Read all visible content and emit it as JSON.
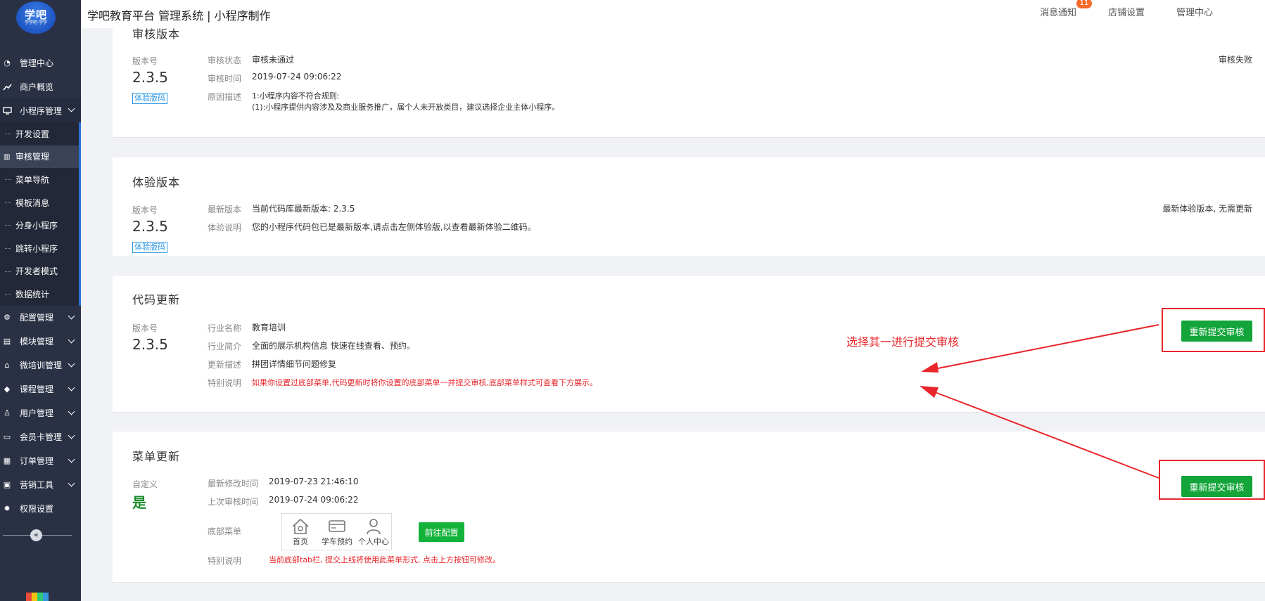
{
  "brand": {
    "logo_text": "学吧",
    "logo_sub": "学学吧·学学"
  },
  "header": {
    "title": "学吧教育平台 管理系统 | 小程序制作",
    "links": {
      "notifications": "消息通知",
      "notifications_badge": "11",
      "shop_settings": "店铺设置",
      "admin_center": "管理中心"
    }
  },
  "sidebar": {
    "items": [
      {
        "label": "管理中心",
        "icon": "dashboard-icon"
      },
      {
        "label": "商户概览",
        "icon": "chart-line-icon"
      },
      {
        "label": "小程序管理",
        "icon": "monitor-icon"
      },
      {
        "label": "配置管理",
        "icon": "cogs-icon"
      },
      {
        "label": "模块管理",
        "icon": "modules-icon"
      },
      {
        "label": "微培训管理",
        "icon": "home-icon"
      },
      {
        "label": "课程管理",
        "icon": "graduation-cap-icon"
      },
      {
        "label": "用户管理",
        "icon": "user-icon"
      },
      {
        "label": "会员卡管理",
        "icon": "id-card-icon"
      },
      {
        "label": "订单管理",
        "icon": "order-icon"
      },
      {
        "label": "营销工具",
        "icon": "briefcase-icon"
      },
      {
        "label": "权限设置",
        "icon": "gear-icon"
      }
    ],
    "subitems": [
      "开发设置",
      "审核管理",
      "菜单导航",
      "模板消息",
      "分身小程序",
      "跳转小程序",
      "开发者模式",
      "数据统计"
    ]
  },
  "audit": {
    "title": "审核版本",
    "version_label": "版本号",
    "version": "2.3.5",
    "tag": "体验版码",
    "status_label": "审核状态",
    "status": "审核未通过",
    "time_label": "审核时间",
    "time": "2019-07-24 09:06:22",
    "reason_label": "原因描述",
    "reason_line1": "1:小程序内容不符合规则:",
    "reason_line2": "(1):小程序提供内容涉及及商业服务推广，属个人未开放类目，建议选择企业主体小程序。",
    "right_status": "审核失败"
  },
  "trial": {
    "title": "体验版本",
    "version_label": "版本号",
    "version": "2.3.5",
    "tag": "体验版码",
    "latest_label": "最新版本",
    "latest": "当前代码库最新版本: 2.3.5",
    "desc_label": "体验说明",
    "desc": "您的小程序代码包已是最新版本,请点击左侧体验版,以查看最新体验二维码。",
    "right_status": "最新体验版本, 无需更新"
  },
  "code_update": {
    "title": "代码更新",
    "version_label": "版本号",
    "version": "2.3.5",
    "industry_label": "行业名称",
    "industry": "教育培训",
    "intro_label": "行业简介",
    "intro": "全面的展示机构信息 快速在线查看、预约。",
    "update_label": "更新描述",
    "update": "拼团详情细节问题修复",
    "special_label": "特别说明",
    "special": "如果你设置过底部菜单,代码更新时将你设置的底部菜单一并提交审核,底部菜单样式可查看下方展示。",
    "button": "重新提交审核"
  },
  "menu_update": {
    "title": "菜单更新",
    "custom_label": "自定义",
    "custom_value": "是",
    "modified_label": "最新修改时间",
    "modified": "2019-07-23 21:46:10",
    "last_audit_label": "上次审核时间",
    "last_audit": "2019-07-24 09:06:22",
    "bottom_menu_label": "底部菜单",
    "menu_items": [
      {
        "label": "首页",
        "icon": "home-outline-icon"
      },
      {
        "label": "学车预约",
        "icon": "card-outline-icon"
      },
      {
        "label": "个人中心",
        "icon": "person-outline-icon"
      }
    ],
    "goto_config": "前往配置",
    "special_label": "特别说明",
    "special": "当前底部tab栏, 提交上线将使用此菜单形式, 点击上方按钮可修改。",
    "button": "重新提交审核"
  },
  "annotation": {
    "text": "选择其一进行提交审核",
    "color": "#e8262b"
  }
}
